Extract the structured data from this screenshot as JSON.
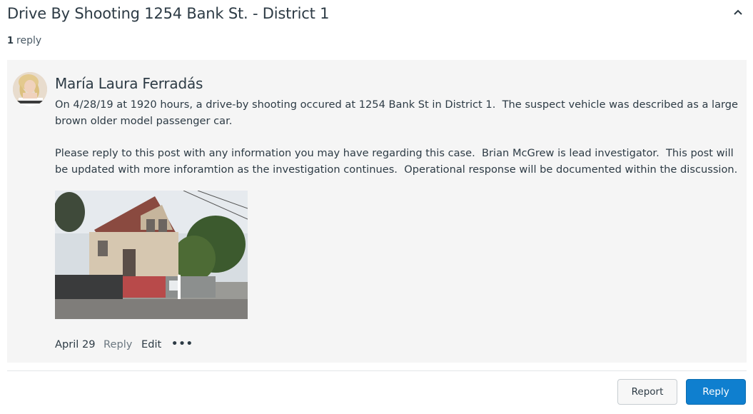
{
  "topic": {
    "title": "Drive By Shooting 1254 Bank St. - District 1",
    "reply_count": "1",
    "reply_label": "reply"
  },
  "icons": {
    "collapse": "chevron-up-icon",
    "more": "more-options-icon"
  },
  "entry": {
    "author": "María Laura Ferradás",
    "paragraphs": [
      "On 4/28/19 at 1920 hours, a drive-by shooting occured at 1254 Bank St in District 1.  The suspect vehicle was described as a large brown older model passenger car.",
      "Please reply to this post with any information you may have regarding this case.  Brian McGrew is lead investigator.  This post will be updated with more inforamtion as the investigation continues.  Operational response will be documented within the discussion."
    ],
    "date": "April 29",
    "reply_action": "Reply",
    "edit_action": "Edit",
    "more_action": "•••"
  },
  "footer": {
    "report_label": "Report",
    "reply_label": "Reply"
  },
  "colors": {
    "text": "#2d3b45",
    "entry_background": "#f5f5f5",
    "primary_button": "#0f7fcf"
  }
}
